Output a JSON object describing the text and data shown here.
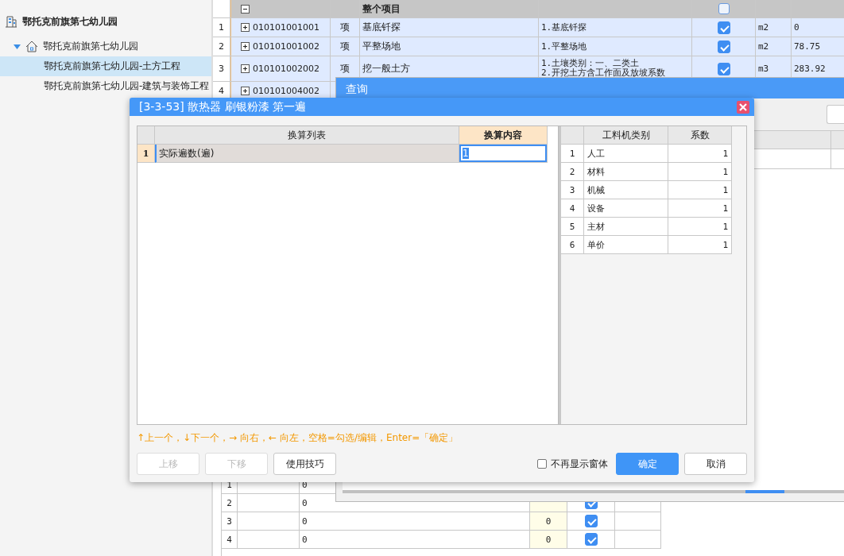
{
  "sidebar": {
    "title": "鄂托克前旗第七幼儿园",
    "tree": [
      {
        "label": "鄂托克前旗第七幼儿园",
        "expanded": true,
        "children": [
          {
            "label": "鄂托克前旗第七幼儿园-土方工程",
            "selected": true
          },
          {
            "label": "鄂托克前旗第七幼儿园-建筑与装饰工程",
            "selected": false
          }
        ]
      }
    ]
  },
  "project_grid": {
    "header": {
      "title": "整个项目",
      "expanded": true,
      "checked": false
    },
    "rows": [
      {
        "number": "1",
        "code": "010101001001",
        "expanded": false,
        "type": "项",
        "name": "基底钎探",
        "features": [
          "1.基底钎探"
        ],
        "checked": true,
        "unit": "m2",
        "quantity": "0"
      },
      {
        "number": "2",
        "code": "010101001002",
        "expanded": false,
        "type": "项",
        "name": "平整场地",
        "features": [
          "1.平整场地"
        ],
        "checked": true,
        "unit": "m2",
        "quantity": "78.75"
      },
      {
        "number": "3",
        "code": "010101002002",
        "expanded": false,
        "type": "项",
        "name": "挖一般土方",
        "features": [
          "1.土壤类别：一、二类土",
          "2.开挖土方含工作面及放坡系数"
        ],
        "checked": true,
        "unit": "m3",
        "quantity": "283.92"
      },
      {
        "number": "4",
        "code": "010101004002",
        "expanded": false
      }
    ]
  },
  "lower_grid": {
    "rows": [
      {
        "number": "1",
        "value": "0"
      },
      {
        "number": "2",
        "value": "0",
        "checked": true
      },
      {
        "number": "3",
        "value": "0",
        "amount": "0",
        "checked": true
      },
      {
        "number": "4",
        "value": "0",
        "amount": "0",
        "checked": true
      }
    ]
  },
  "query_window": {
    "title": "查询"
  },
  "dialog": {
    "title": "[3-3-53] 散热器 刷银粉漆 第一遍",
    "conversion_table": {
      "columns": [
        "换算列表",
        "换算内容"
      ],
      "rows": [
        {
          "number": "1",
          "name": "实际遍数(遍)",
          "value": "1",
          "selected": true
        }
      ]
    },
    "factor_table": {
      "columns": [
        "工料机类别",
        "系数"
      ],
      "rows": [
        {
          "number": "1",
          "category": "人工",
          "factor": "1"
        },
        {
          "number": "2",
          "category": "材料",
          "factor": "1"
        },
        {
          "number": "3",
          "category": "机械",
          "factor": "1"
        },
        {
          "number": "4",
          "category": "设备",
          "factor": "1"
        },
        {
          "number": "5",
          "category": "主材",
          "factor": "1"
        },
        {
          "number": "6",
          "category": "单价",
          "factor": "1"
        }
      ]
    },
    "hint": "↑上一个，↓下一个，→ 向右，← 向左，空格=勾选/编辑，Enter=「确定」",
    "buttons": [
      {
        "label": "上移",
        "disabled": true
      },
      {
        "label": "下移",
        "disabled": true
      },
      {
        "label": "使用技巧",
        "disabled": false
      }
    ],
    "dont_show": {
      "label": "不再显示窗体",
      "checked": false
    },
    "actions": [
      {
        "label": "确定",
        "kind": "primary"
      },
      {
        "label": "取消",
        "kind": "default"
      }
    ]
  }
}
